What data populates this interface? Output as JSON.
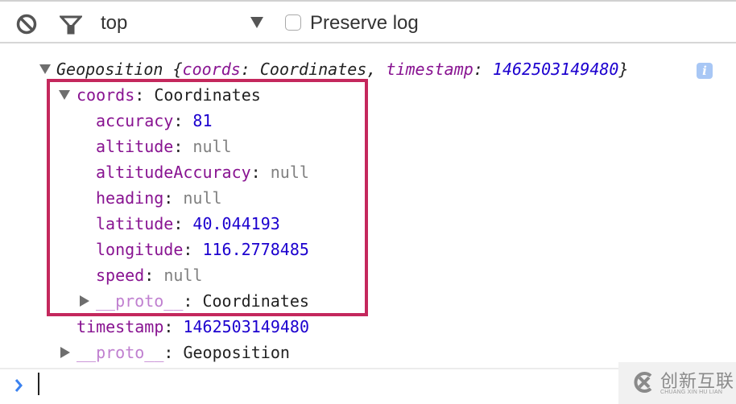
{
  "toolbar": {
    "clear_icon": "clear-console-icon",
    "filter_icon": "filter-icon",
    "context": "top",
    "preserve_log_label": "Preserve log",
    "preserve_log_checked": false
  },
  "console": {
    "summary": {
      "type": "Geoposition",
      "open_brace": " {",
      "coords_key": "coords",
      "colon_sep": ": ",
      "coords_type": "Coordinates",
      "comma": ", ",
      "timestamp_key": "timestamp",
      "timestamp_value": "1462503149480",
      "close_brace": "}",
      "info_badge": "i"
    },
    "coords": {
      "key": "coords",
      "type": "Coordinates",
      "properties": [
        {
          "key": "accuracy",
          "value": "81",
          "kind": "number"
        },
        {
          "key": "altitude",
          "value": "null",
          "kind": "null"
        },
        {
          "key": "altitudeAccuracy",
          "value": "null",
          "kind": "null"
        },
        {
          "key": "heading",
          "value": "null",
          "kind": "null"
        },
        {
          "key": "latitude",
          "value": "40.044193",
          "kind": "number"
        },
        {
          "key": "longitude",
          "value": "116.2778485",
          "kind": "number"
        },
        {
          "key": "speed",
          "value": "null",
          "kind": "null"
        }
      ],
      "proto_key": "__proto__",
      "proto_type": "Coordinates"
    },
    "timestamp": {
      "key": "timestamp",
      "value": "1462503149480"
    },
    "proto": {
      "key": "__proto__",
      "type": "Geoposition"
    },
    "colon": ": "
  },
  "watermark": {
    "cn": "创新互联",
    "en": "CHUANG XIN HU LIAN"
  },
  "colors": {
    "highlight_border": "#c4285d",
    "key": "#881391",
    "number": "#1c00cf",
    "null": "#808080",
    "prompt": "#3b82f0"
  }
}
